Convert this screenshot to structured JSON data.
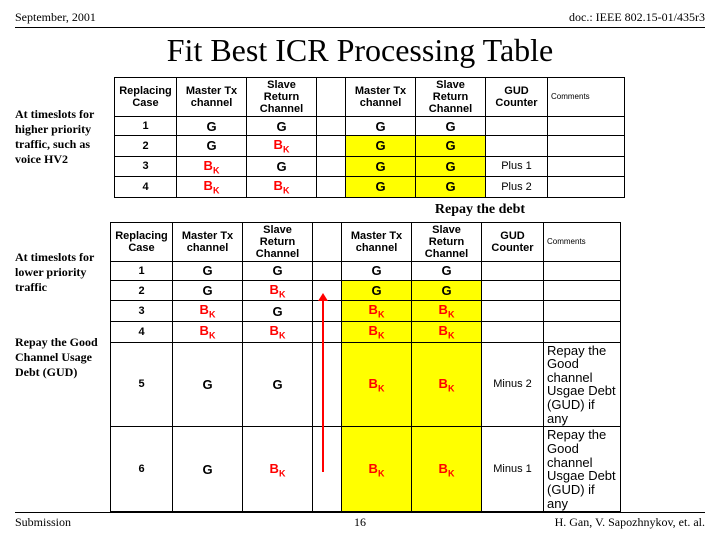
{
  "header": {
    "left": "September, 2001",
    "right": "doc.: IEEE 802.15-01/435r3"
  },
  "title": "Fit Best ICR Processing Table",
  "note1": "At timeslots for higher priority traffic, such as voice HV2",
  "note2": "At timeslots for lower priority traffic",
  "note3": "Repay the Good Channel Usage Debt (GUD)",
  "repay_label": "Repay the debt",
  "cols": {
    "c1": "Replacing Case",
    "c2": "Master Tx channel",
    "c3": "Slave Return Channel",
    "c4": "Master Tx channel",
    "c5": "Slave Return Channel",
    "c6": "GUD Counter",
    "c7": "Comments"
  },
  "G": "G",
  "BK": "B",
  "BKs": "K",
  "t1": {
    "r1": {
      "case": "1",
      "gud": "",
      "c": ""
    },
    "r2": {
      "case": "2",
      "gud": "",
      "c": ""
    },
    "r3": {
      "case": "3",
      "gud": "Plus 1",
      "c": ""
    },
    "r4": {
      "case": "4",
      "gud": "Plus 2",
      "c": ""
    }
  },
  "t2": {
    "r1": {
      "case": "1",
      "gud": "",
      "c": ""
    },
    "r2": {
      "case": "2",
      "gud": "",
      "c": ""
    },
    "r3": {
      "case": "3",
      "gud": "",
      "c": ""
    },
    "r4": {
      "case": "4",
      "gud": "",
      "c": ""
    },
    "r5": {
      "case": "5",
      "gud": "Minus 2",
      "c": "Repay the Good channel Usgae Debt (GUD) if any"
    },
    "r6": {
      "case": "6",
      "gud": "Minus 1",
      "c": "Repay the Good channel Usgae Debt (GUD) if any"
    }
  },
  "footer": {
    "left": "Submission",
    "center": "16",
    "right": "H. Gan, V. Sapozhnykov, et. al."
  }
}
